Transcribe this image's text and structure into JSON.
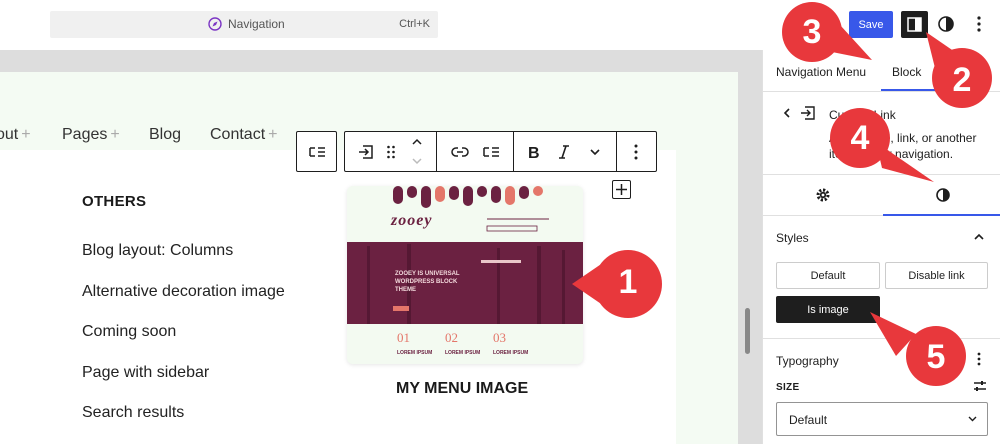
{
  "topbar": {
    "command_label": "Navigation",
    "command_shortcut": "Ctrl+K",
    "save_label": "Save"
  },
  "canvas": {
    "nav_items": [
      {
        "label": "out",
        "plus": "+"
      },
      {
        "label": "Pages",
        "plus": "+"
      },
      {
        "label": "Blog",
        "plus": ""
      },
      {
        "label": "Contact",
        "plus": "+"
      }
    ],
    "submenu_heading": "OTHERS",
    "submenu_items": [
      "Blog layout: Columns",
      "Alternative decoration image",
      "Coming soon",
      "Page with sidebar",
      "Search results"
    ],
    "menu_image": {
      "logo_text": "zooey",
      "hero_text": "Zooey is universal WordPress block theme",
      "numbers": [
        "01",
        "02",
        "03"
      ],
      "caption_small": "LOREM IPSUM"
    },
    "menu_caption": "MY MENU IMAGE"
  },
  "sidebar": {
    "tabs": [
      "Navigation Menu",
      "Block"
    ],
    "block_title": "Custom Link",
    "block_desc": "Add a page, link, or another item to your navigation.",
    "styles_title": "Styles",
    "style_options": [
      "Default",
      "Disable link",
      "Is image"
    ],
    "typography_title": "Typography",
    "size_label": "SIZE",
    "size_value": "Default"
  },
  "callouts": [
    "1",
    "2",
    "3",
    "4",
    "5"
  ],
  "colors": {
    "accent": "#3858e9",
    "callout_red": "#e8383c",
    "theme_maroon": "#6b2141",
    "theme_coral": "#e4766a"
  }
}
